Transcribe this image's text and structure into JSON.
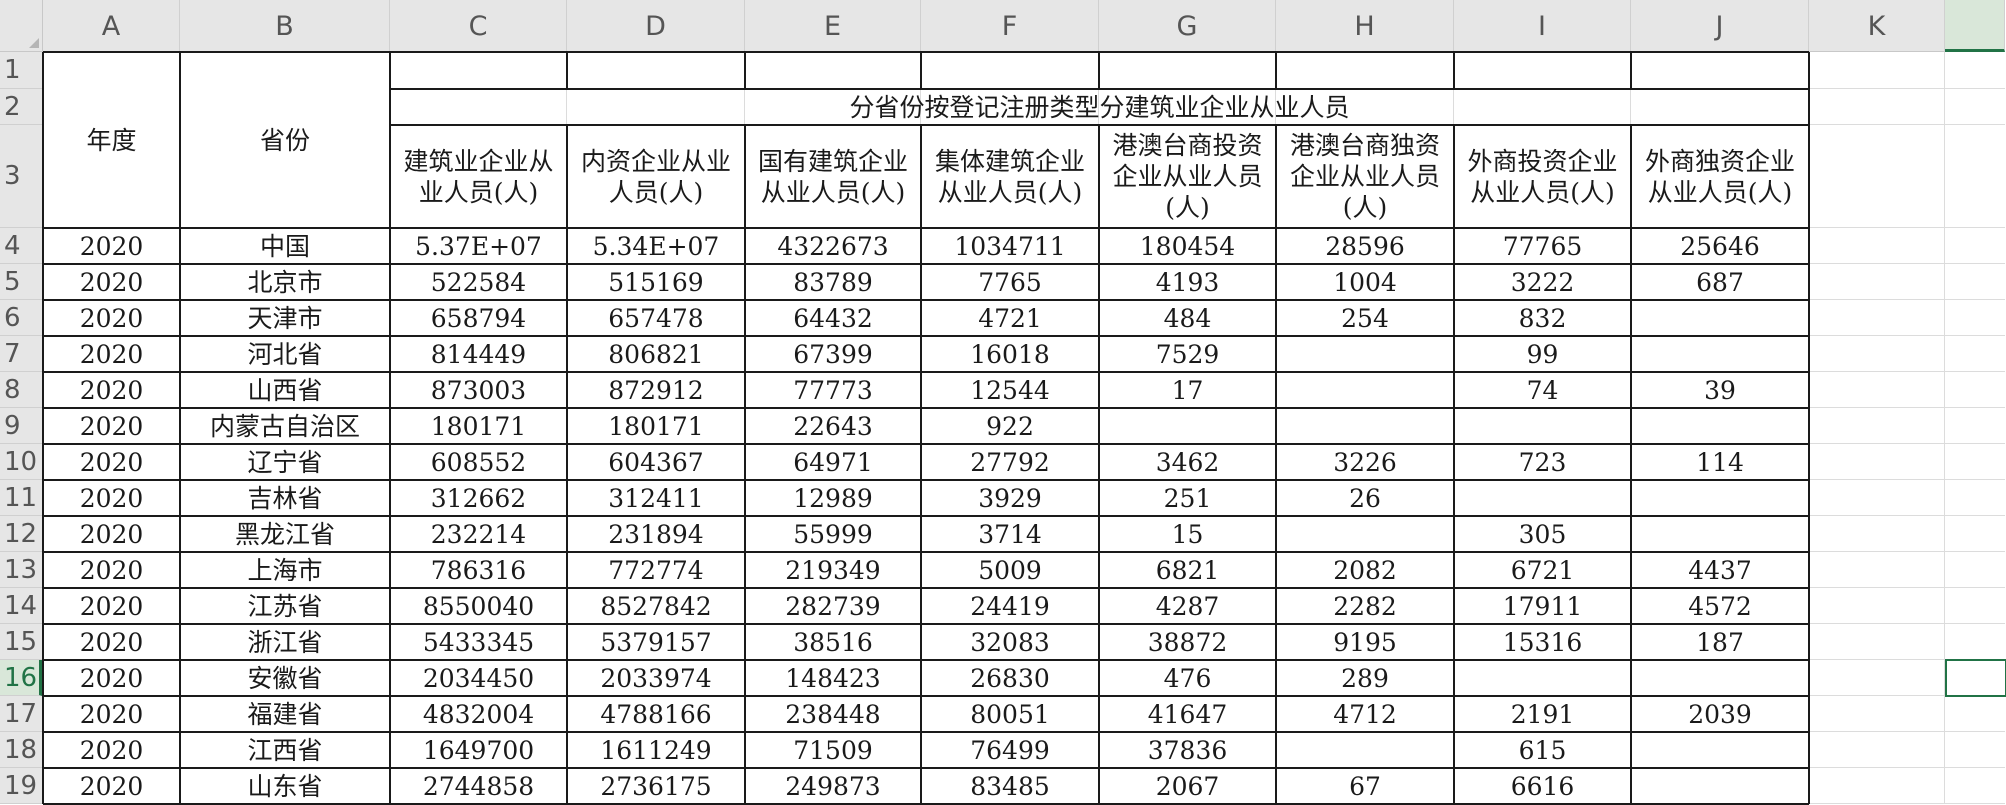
{
  "columns": [
    "A",
    "B",
    "C",
    "D",
    "E",
    "F",
    "G",
    "H",
    "I",
    "J",
    "K"
  ],
  "rows": [
    "1",
    "2",
    "3",
    "4",
    "5",
    "6",
    "7",
    "8",
    "9",
    "10",
    "11",
    "12",
    "13",
    "14",
    "15",
    "16",
    "17",
    "18",
    "19"
  ],
  "selected": {
    "column": "L",
    "row": "16"
  },
  "header": {
    "year": "年度",
    "province": "省份",
    "group_title": "分省份按登记注册类型分建筑业企业从业人员",
    "sub": [
      "建筑业企业从业人员(人)",
      "内资企业从业人员(人)",
      "国有建筑企业从业人员(人)",
      "集体建筑企业从业人员(人)",
      "港澳台商投资企业从业人员(人)",
      "港澳台商独资企业从业人员(人)",
      "外商投资企业从业人员(人)",
      "外商独资企业从业人员(人)"
    ]
  },
  "data": [
    [
      "2020",
      "中国",
      "5.37E+07",
      "5.34E+07",
      "4322673",
      "1034711",
      "180454",
      "28596",
      "77765",
      "25646"
    ],
    [
      "2020",
      "北京市",
      "522584",
      "515169",
      "83789",
      "7765",
      "4193",
      "1004",
      "3222",
      "687"
    ],
    [
      "2020",
      "天津市",
      "658794",
      "657478",
      "64432",
      "4721",
      "484",
      "254",
      "832",
      ""
    ],
    [
      "2020",
      "河北省",
      "814449",
      "806821",
      "67399",
      "16018",
      "7529",
      "",
      "99",
      ""
    ],
    [
      "2020",
      "山西省",
      "873003",
      "872912",
      "77773",
      "12544",
      "17",
      "",
      "74",
      "39"
    ],
    [
      "2020",
      "内蒙古自治区",
      "180171",
      "180171",
      "22643",
      "922",
      "",
      "",
      "",
      ""
    ],
    [
      "2020",
      "辽宁省",
      "608552",
      "604367",
      "64971",
      "27792",
      "3462",
      "3226",
      "723",
      "114"
    ],
    [
      "2020",
      "吉林省",
      "312662",
      "312411",
      "12989",
      "3929",
      "251",
      "26",
      "",
      ""
    ],
    [
      "2020",
      "黑龙江省",
      "232214",
      "231894",
      "55999",
      "3714",
      "15",
      "",
      "305",
      ""
    ],
    [
      "2020",
      "上海市",
      "786316",
      "772774",
      "219349",
      "5009",
      "6821",
      "2082",
      "6721",
      "4437"
    ],
    [
      "2020",
      "江苏省",
      "8550040",
      "8527842",
      "282739",
      "24419",
      "4287",
      "2282",
      "17911",
      "4572"
    ],
    [
      "2020",
      "浙江省",
      "5433345",
      "5379157",
      "38516",
      "32083",
      "38872",
      "9195",
      "15316",
      "187"
    ],
    [
      "2020",
      "安徽省",
      "2034450",
      "2033974",
      "148423",
      "26830",
      "476",
      "289",
      "",
      ""
    ],
    [
      "2020",
      "福建省",
      "4832004",
      "4788166",
      "238448",
      "80051",
      "41647",
      "4712",
      "2191",
      "2039"
    ],
    [
      "2020",
      "江西省",
      "1649700",
      "1611249",
      "71509",
      "76499",
      "37836",
      "",
      "615",
      ""
    ],
    [
      "2020",
      "山东省",
      "2744858",
      "2736175",
      "249873",
      "83485",
      "2067",
      "67",
      "6616",
      ""
    ]
  ]
}
